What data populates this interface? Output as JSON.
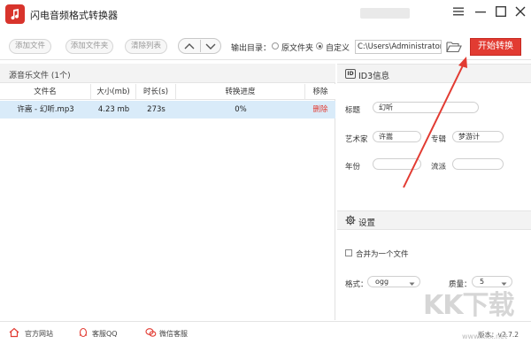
{
  "window": {
    "title": "闪电音频格式转换器",
    "accent_color": "#e23b32",
    "controls": [
      "menu-icon",
      "minimize-icon",
      "maximize-icon",
      "close-icon"
    ]
  },
  "toolbar": {
    "add_file": "添加文件",
    "add_folder": "添加文件夹",
    "clear_list": "清除列表",
    "output_dir_label": "输出目录：",
    "option_source": "原文件夹",
    "option_custom": "自定义",
    "selected_option": "自定义",
    "output_path": "C:\\Users\\Administrator\\",
    "start_button": "开始转换"
  },
  "file_list": {
    "header": "源音乐文件 (1个)",
    "columns": [
      "文件名",
      "大小(mb)",
      "时长(s)",
      "转换进度",
      "移除"
    ],
    "rows": [
      {
        "name": "许嵩 - 幻听.mp3",
        "size": "4.23 mb",
        "duration": "273s",
        "progress": "0%",
        "remove": "删除"
      }
    ]
  },
  "id3": {
    "section_title": "ID3信息",
    "badge": "ID",
    "title_label": "标题",
    "title_value": "幻听",
    "artist_label": "艺术家",
    "artist_value": "许嵩",
    "album_label": "专辑",
    "album_value": "梦游计",
    "year_label": "年份",
    "year_value": "",
    "genre_label": "流派",
    "genre_value": ""
  },
  "settings": {
    "section_title": "设置",
    "merge_label": "合并为一个文件",
    "format_label": "格式：",
    "format_value": "ogg",
    "quality_label": "质量：",
    "quality_value": "5"
  },
  "footer": {
    "website": "官方网站",
    "qq": "客服QQ",
    "wechat": "微信客服",
    "version": "版本：v2.7.2"
  },
  "watermark": {
    "text": "KK下载",
    "url": "www.kkx.net"
  }
}
